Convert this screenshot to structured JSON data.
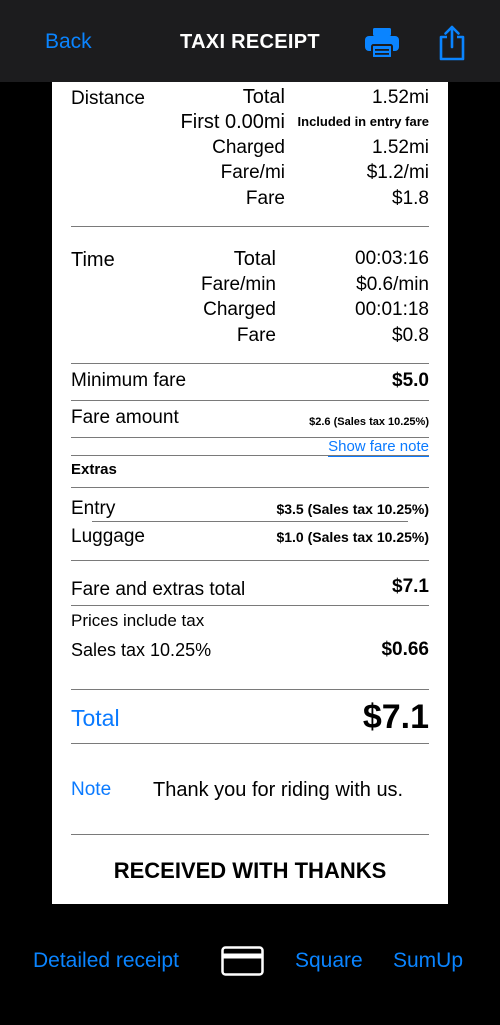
{
  "nav": {
    "back_label": "Back",
    "title": "TAXI RECEIPT"
  },
  "distance": {
    "label": "Distance",
    "total_label": "Total",
    "total_value": "1.52mi",
    "first_label": "First 0.00mi",
    "first_value": "Included in entry fare",
    "charged_label": "Charged",
    "charged_value": "1.52mi",
    "rate_label": "Fare/mi",
    "rate_value": "$1.2/mi",
    "fare_label": "Fare",
    "fare_value": "$1.8"
  },
  "time": {
    "label": "Time",
    "total_label": "Total",
    "total_value": "00:03:16",
    "rate_label": "Fare/min",
    "rate_value": "$0.6/min",
    "charged_label": "Charged",
    "charged_value": "00:01:18",
    "fare_label": "Fare",
    "fare_value": "$0.8"
  },
  "minimum_fare": {
    "label": "Minimum fare",
    "value": "$5.0"
  },
  "fare_amount": {
    "label": "Fare amount",
    "value": "$2.6 (Sales tax 10.25%)"
  },
  "show_fare_note": "Show fare note",
  "extras": {
    "heading": "Extras",
    "items": [
      {
        "label": "Entry",
        "value": "$3.5 (Sales tax 10.25%)"
      },
      {
        "label": "Luggage",
        "value": "$1.0 (Sales tax 10.25%)"
      }
    ]
  },
  "fare_extras_total": {
    "label": "Fare and extras total",
    "value": "$7.1"
  },
  "prices_include_tax": "Prices include tax",
  "sales_tax": {
    "label": "Sales tax 10.25%",
    "value": "$0.66"
  },
  "total": {
    "label": "Total",
    "value": "$7.1"
  },
  "note": {
    "label": "Note",
    "text": "Thank you for riding with us."
  },
  "received": "RECEIVED WITH THANKS",
  "bottom": {
    "detailed_receipt": "Detailed receipt",
    "square": "Square",
    "sumup": "SumUp"
  },
  "colors": {
    "accent": "#0a84ff",
    "nav_background": "#1c1c1e",
    "receipt_background": "#ffffff"
  },
  "icons": {
    "print": "printer-icon",
    "share": "share-icon",
    "card": "credit-card-icon"
  }
}
